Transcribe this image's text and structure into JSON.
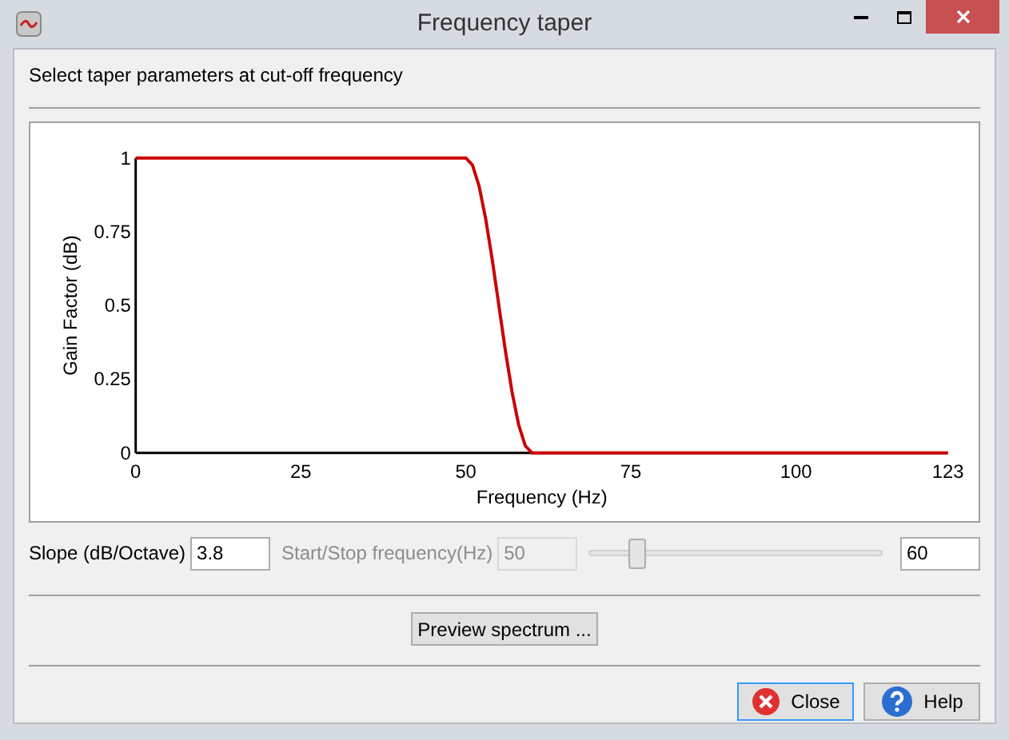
{
  "window": {
    "title": "Frequency taper"
  },
  "instruction": "Select taper parameters at cut-off frequency",
  "chart_data": {
    "type": "line",
    "xlabel": "Frequency (Hz)",
    "ylabel": "Gain Factor (dB)",
    "xlim": [
      0,
      123
    ],
    "ylim": [
      0,
      1
    ],
    "xticks": [
      0,
      25,
      50,
      75,
      100,
      123
    ],
    "yticks": [
      {
        "value": 0,
        "label": "0"
      },
      {
        "value": 0.25,
        "label": "0.25"
      },
      {
        "value": 0.5,
        "label": "0.5"
      },
      {
        "value": 0.75,
        "label": "0.75"
      },
      {
        "value": 1,
        "label": "1"
      }
    ],
    "x": [
      0,
      50,
      51,
      52,
      53,
      54,
      55,
      56,
      57,
      58,
      59,
      60,
      123
    ],
    "series": [
      {
        "color": "#cc0000",
        "values": [
          1,
          1,
          0.976,
          0.905,
          0.794,
          0.655,
          0.5,
          0.345,
          0.206,
          0.095,
          0.024,
          0,
          0
        ]
      }
    ]
  },
  "slope": {
    "label": "Slope (dB/Octave)",
    "value": "3.8"
  },
  "start_stop": {
    "label": "Start/Stop frequency(Hz)",
    "start_value": "50",
    "disabled": true,
    "level": 0.16,
    "stop_value": "60"
  },
  "preview_button": "Preview spectrum ...",
  "buttons": [
    {
      "kind": "close",
      "label": "Close",
      "focused": true
    },
    {
      "kind": "help",
      "label": "Help",
      "focused": false
    }
  ]
}
